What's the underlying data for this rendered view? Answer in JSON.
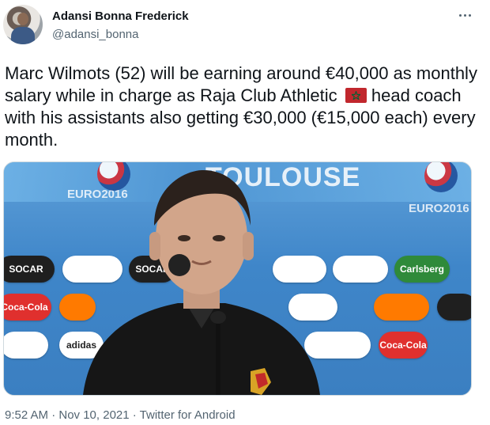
{
  "tweet": {
    "author_name": "Adansi Bonna Frederick",
    "author_handle": "@adansi_bonna",
    "text_part1": "Marc Wilmots (52) will be earning around €40,000 as monthly salary while in charge as Raja Club Athletic",
    "flag_icon": "morocco-flag-emoji",
    "text_part2": "head coach with his assistants also getting €30,000 (€15,000 each) every month.",
    "timestamp": "9:52 AM · Nov 10, 2021",
    "separator": " · ",
    "source": "Twitter for Android"
  },
  "media": {
    "wall_text": "TOULOUSE",
    "euro_label_left": "EURO2016",
    "euro_label_right": "EURO2016",
    "sponsors": [
      "SOCAR",
      "Coca-Cola",
      "adidas",
      "SOCAR",
      "Coca-Cola",
      "Carlsberg"
    ]
  },
  "colors": {
    "text": "#0f1419",
    "secondary": "#536471",
    "border": "#cfd9de",
    "flag_red": "#c1272d",
    "flag_green": "#006233"
  },
  "icons": {
    "more": "more-dots-icon"
  }
}
